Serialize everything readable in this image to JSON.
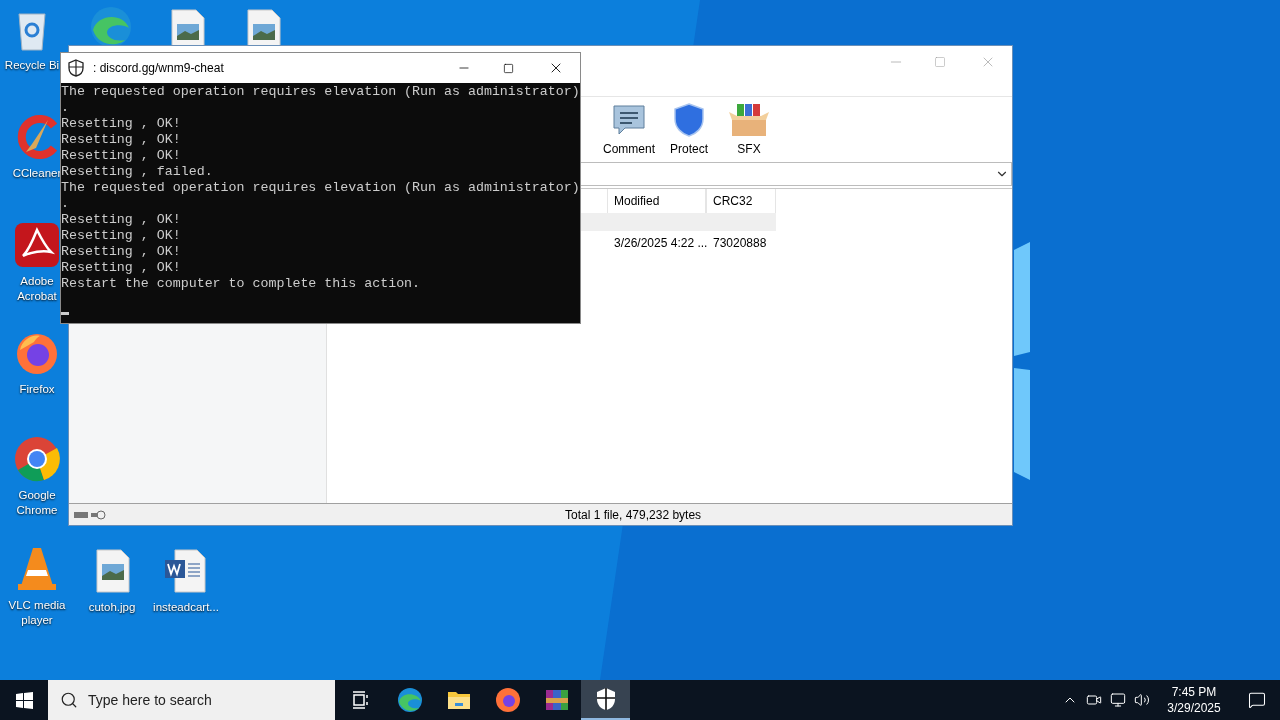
{
  "desktop_icons": [
    {
      "kind": "recycle",
      "label": "Recycle Bi"
    },
    {
      "kind": "edge"
    },
    {
      "kind": "image"
    },
    {
      "kind": "image"
    },
    {
      "kind": "ccleaner",
      "label": "CCleaner"
    },
    {
      "kind": "acrobat",
      "label": "Adobe Acrobat"
    },
    {
      "kind": "firefox",
      "label": "Firefox"
    },
    {
      "kind": "chrome",
      "label": "Google Chrome"
    },
    {
      "kind": "vlc",
      "label": "VLC media player"
    },
    {
      "kind": "image",
      "label": "cutoh.jpg"
    },
    {
      "kind": "word",
      "label": "insteadcart..."
    }
  ],
  "archiver": {
    "toolbar": [
      {
        "kind": "comment",
        "label": "Comment"
      },
      {
        "kind": "protect",
        "label": "Protect"
      },
      {
        "kind": "sfx",
        "label": "SFX"
      }
    ],
    "columns": [
      "Modified",
      "CRC32"
    ],
    "rows": [
      {
        "cells": [
          "3/26/2025 4:22 ...",
          "73020888"
        ]
      }
    ],
    "status": "Total 1 file, 479,232 bytes"
  },
  "console": {
    "title": ": discord.gg/wnm9-cheat",
    "lines": [
      "The requested operation requires elevation (Run as administrator)",
      ".",
      "Resetting , OK!",
      "Resetting , OK!",
      "Resetting , OK!",
      "Resetting , failed.",
      "The requested operation requires elevation (Run as administrator)",
      ".",
      "Resetting , OK!",
      "Resetting , OK!",
      "Resetting , OK!",
      "Resetting , OK!",
      "Restart the computer to complete this action."
    ]
  },
  "taskbar": {
    "search": {
      "placeholder": "Type here to search"
    },
    "apps": [
      {
        "kind": "taskview",
        "selected": false
      },
      {
        "kind": "edge",
        "selected": false
      },
      {
        "kind": "folder",
        "selected": false
      },
      {
        "kind": "firefox",
        "selected": false
      },
      {
        "kind": "archive",
        "selected": false
      },
      {
        "kind": "defender",
        "selected": true
      }
    ],
    "time": "7:45 PM",
    "date": "3/29/2025"
  }
}
